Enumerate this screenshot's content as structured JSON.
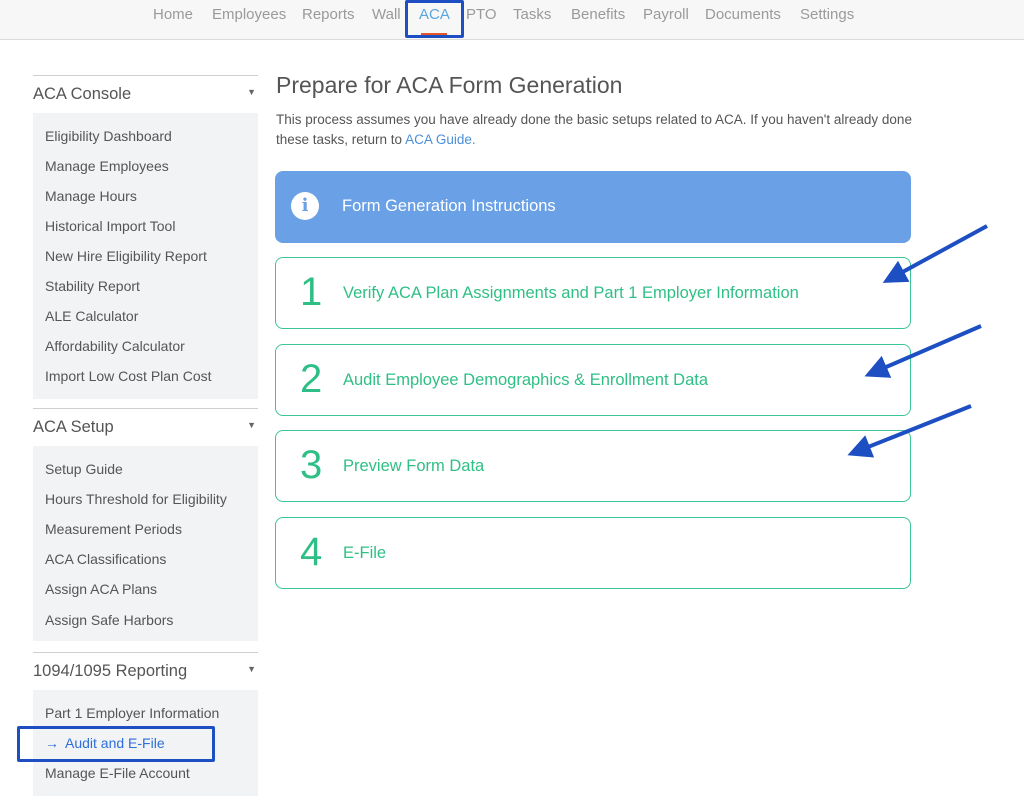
{
  "nav": {
    "items": [
      "Home",
      "Employees",
      "Reports",
      "Wall",
      "ACA",
      "PTO",
      "Tasks",
      "Benefits",
      "Payroll",
      "Documents",
      "Settings"
    ],
    "active": "ACA",
    "accent_color": "#e8542a"
  },
  "sidebar": {
    "sections": [
      {
        "title": "ACA Console",
        "items": [
          "Eligibility Dashboard",
          "Manage Employees",
          "Manage Hours",
          "Historical Import Tool",
          "New Hire Eligibility Report",
          "Stability Report",
          "ALE Calculator",
          "Affordability Calculator",
          "Import Low Cost Plan Cost"
        ]
      },
      {
        "title": "ACA Setup",
        "items": [
          "Setup Guide",
          "Hours Threshold for Eligibility",
          "Measurement Periods",
          "ACA Classifications",
          "Assign ACA Plans",
          "Assign Safe Harbors"
        ]
      },
      {
        "title": "1094/1095 Reporting",
        "items": [
          "Part 1 Employer Information",
          "Audit and E-File",
          "Manage E-File Account"
        ]
      }
    ],
    "active_item": "Audit and E-File"
  },
  "main": {
    "title": "Prepare for ACA Form Generation",
    "intro_text": "This process assumes you have already done the basic setups related to ACA. If you haven't already done these tasks, return to ",
    "intro_link": "ACA Guide.",
    "info_label": "Form Generation Instructions",
    "info_icon": "info-circle-icon",
    "steps": [
      {
        "number": "1",
        "label": "Verify ACA Plan Assignments and Part 1 Employer Information"
      },
      {
        "number": "2",
        "label": "Audit Employee Demographics & Enrollment Data"
      },
      {
        "number": "3",
        "label": "Preview Form Data"
      },
      {
        "number": "4",
        "label": "E-File"
      }
    ]
  },
  "colors": {
    "info_panel": "#6aa0e6",
    "step_green": "#2fbf86",
    "annotation_blue": "#1d4fc2",
    "link_blue": "#4a90d9"
  }
}
